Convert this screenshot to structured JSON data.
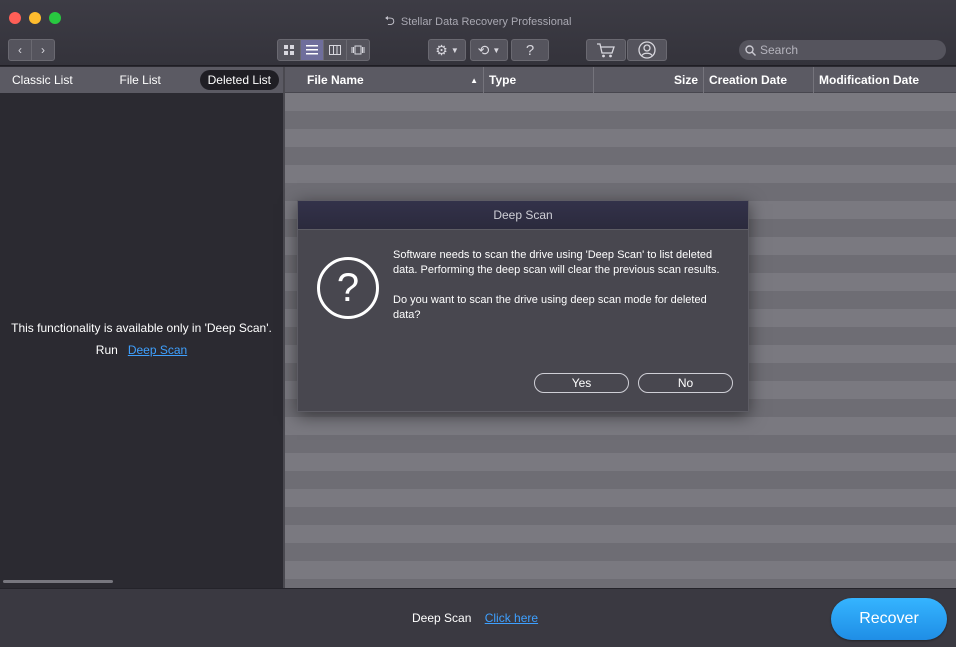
{
  "window": {
    "title": "Stellar Data Recovery Professional",
    "back_icon": "back-arrow-icon"
  },
  "toolbar": {
    "nav_back": "‹",
    "nav_forward": "›",
    "views": [
      "icon-view",
      "list-view",
      "column-view",
      "coverflow-view"
    ],
    "help_label": "?",
    "search_placeholder": "Search",
    "search_value": ""
  },
  "left_panel": {
    "tabs": [
      "Classic List",
      "File List",
      "Deleted List"
    ],
    "active_tab": "Deleted List",
    "message": "This functionality is available only in 'Deep Scan'.",
    "run_label": "Run",
    "run_link": "Deep Scan"
  },
  "table": {
    "columns": [
      "File Name",
      "Type",
      "Size",
      "Creation Date",
      "Modification Date"
    ],
    "sort_indicator": "▲",
    "rows": []
  },
  "bottom": {
    "deep_scan_label": "Deep Scan",
    "click_here": "Click here",
    "recover_label": "Recover"
  },
  "dialog": {
    "title": "Deep Scan",
    "icon": "?",
    "message1": "Software needs to scan the drive using 'Deep Scan' to list deleted data. Performing the deep scan will clear the previous scan results.",
    "message2": "Do you want to scan the drive using deep scan mode for deleted data?",
    "yes_label": "Yes",
    "no_label": "No"
  }
}
